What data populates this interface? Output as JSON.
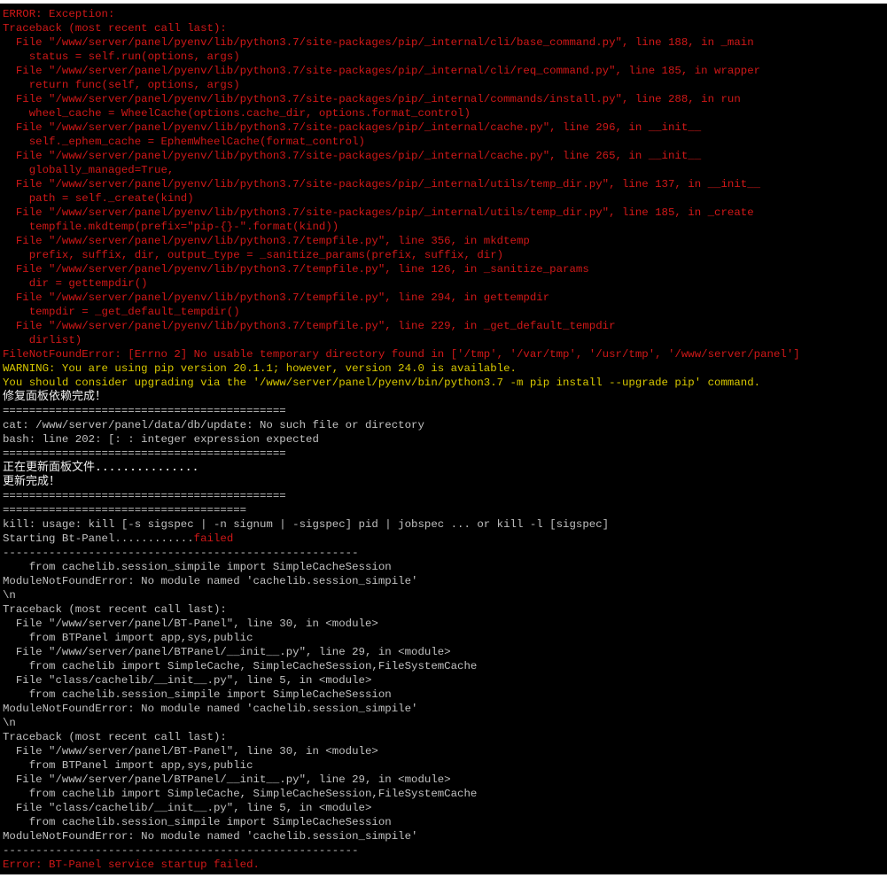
{
  "colors": {
    "red": "#d01818",
    "yellow": "#d8c800",
    "gray": "#c0c0c0",
    "white": "#f0f0f0",
    "background": "#000000"
  },
  "terminal": {
    "lines": [
      {
        "segs": [
          {
            "t": "ERROR: Exception:",
            "c": "red"
          }
        ]
      },
      {
        "segs": [
          {
            "t": "Traceback (most recent call last):",
            "c": "red"
          }
        ]
      },
      {
        "segs": [
          {
            "t": "  File \"/www/server/panel/pyenv/lib/python3.7/site-packages/pip/_internal/cli/base_command.py\", line 188, in _main",
            "c": "red"
          }
        ]
      },
      {
        "segs": [
          {
            "t": "    status = self.run(options, args)",
            "c": "red"
          }
        ]
      },
      {
        "segs": [
          {
            "t": "  File \"/www/server/panel/pyenv/lib/python3.7/site-packages/pip/_internal/cli/req_command.py\", line 185, in wrapper",
            "c": "red"
          }
        ]
      },
      {
        "segs": [
          {
            "t": "    return func(self, options, args)",
            "c": "red"
          }
        ]
      },
      {
        "segs": [
          {
            "t": "  File \"/www/server/panel/pyenv/lib/python3.7/site-packages/pip/_internal/commands/install.py\", line 288, in run",
            "c": "red"
          }
        ]
      },
      {
        "segs": [
          {
            "t": "    wheel_cache = WheelCache(options.cache_dir, options.format_control)",
            "c": "red"
          }
        ]
      },
      {
        "segs": [
          {
            "t": "  File \"/www/server/panel/pyenv/lib/python3.7/site-packages/pip/_internal/cache.py\", line 296, in __init__",
            "c": "red"
          }
        ]
      },
      {
        "segs": [
          {
            "t": "    self._ephem_cache = EphemWheelCache(format_control)",
            "c": "red"
          }
        ]
      },
      {
        "segs": [
          {
            "t": "  File \"/www/server/panel/pyenv/lib/python3.7/site-packages/pip/_internal/cache.py\", line 265, in __init__",
            "c": "red"
          }
        ]
      },
      {
        "segs": [
          {
            "t": "    globally_managed=True,",
            "c": "red"
          }
        ]
      },
      {
        "segs": [
          {
            "t": "  File \"/www/server/panel/pyenv/lib/python3.7/site-packages/pip/_internal/utils/temp_dir.py\", line 137, in __init__",
            "c": "red"
          }
        ]
      },
      {
        "segs": [
          {
            "t": "    path = self._create(kind)",
            "c": "red"
          }
        ]
      },
      {
        "segs": [
          {
            "t": "  File \"/www/server/panel/pyenv/lib/python3.7/site-packages/pip/_internal/utils/temp_dir.py\", line 185, in _create",
            "c": "red"
          }
        ]
      },
      {
        "segs": [
          {
            "t": "    tempfile.mkdtemp(prefix=\"pip-{}-\".format(kind))",
            "c": "red"
          }
        ]
      },
      {
        "segs": [
          {
            "t": "  File \"/www/server/panel/pyenv/lib/python3.7/tempfile.py\", line 356, in mkdtemp",
            "c": "red"
          }
        ]
      },
      {
        "segs": [
          {
            "t": "    prefix, suffix, dir, output_type = _sanitize_params(prefix, suffix, dir)",
            "c": "red"
          }
        ]
      },
      {
        "segs": [
          {
            "t": "  File \"/www/server/panel/pyenv/lib/python3.7/tempfile.py\", line 126, in _sanitize_params",
            "c": "red"
          }
        ]
      },
      {
        "segs": [
          {
            "t": "    dir = gettempdir()",
            "c": "red"
          }
        ]
      },
      {
        "segs": [
          {
            "t": "  File \"/www/server/panel/pyenv/lib/python3.7/tempfile.py\", line 294, in gettempdir",
            "c": "red"
          }
        ]
      },
      {
        "segs": [
          {
            "t": "    tempdir = _get_default_tempdir()",
            "c": "red"
          }
        ]
      },
      {
        "segs": [
          {
            "t": "  File \"/www/server/panel/pyenv/lib/python3.7/tempfile.py\", line 229, in _get_default_tempdir",
            "c": "red"
          }
        ]
      },
      {
        "segs": [
          {
            "t": "    dirlist)",
            "c": "red"
          }
        ]
      },
      {
        "segs": [
          {
            "t": "FileNotFoundError: [Errno 2] No usable temporary directory found in ['/tmp', '/var/tmp', '/usr/tmp', '/www/server/panel']",
            "c": "red"
          }
        ]
      },
      {
        "segs": [
          {
            "t": "WARNING: You are using pip version 20.1.1; however, version 24.0 is available.",
            "c": "yellow"
          }
        ]
      },
      {
        "segs": [
          {
            "t": "You should consider upgrading via the '/www/server/panel/pyenv/bin/python3.7 -m pip install --upgrade pip' command.",
            "c": "yellow"
          }
        ]
      },
      {
        "cjk": true,
        "segs": [
          {
            "t": "修复面板依赖完成！",
            "c": "white"
          }
        ]
      },
      {
        "segs": [
          {
            "t": "===========================================",
            "c": "gray"
          }
        ]
      },
      {
        "segs": [
          {
            "t": "cat: /www/server/panel/data/db/update: No such file or directory",
            "c": "gray"
          }
        ]
      },
      {
        "segs": [
          {
            "t": "bash: line 202: [: : integer expression expected",
            "c": "gray"
          }
        ]
      },
      {
        "segs": [
          {
            "t": "===========================================",
            "c": "gray"
          }
        ]
      },
      {
        "cjk": true,
        "segs": [
          {
            "t": "正在更新面板文件...............",
            "c": "white"
          }
        ]
      },
      {
        "cjk": true,
        "segs": [
          {
            "t": "更新完成！",
            "c": "white"
          }
        ]
      },
      {
        "segs": [
          {
            "t": "===========================================",
            "c": "gray"
          }
        ]
      },
      {
        "segs": [
          {
            "t": "=====================================",
            "c": "gray"
          }
        ]
      },
      {
        "segs": [
          {
            "t": "kill: usage: kill [-s sigspec | -n signum | -sigspec] pid | jobspec ... or kill -l [sigspec]",
            "c": "gray"
          }
        ]
      },
      {
        "segs": [
          {
            "t": "Starting Bt-Panel............",
            "c": "gray"
          },
          {
            "t": "failed",
            "c": "red"
          }
        ]
      },
      {
        "segs": [
          {
            "t": "------------------------------------------------------",
            "c": "gray"
          }
        ]
      },
      {
        "segs": [
          {
            "t": "    from cachelib.session_simpile import SimpleCacheSession",
            "c": "gray"
          }
        ]
      },
      {
        "segs": [
          {
            "t": "ModuleNotFoundError: No module named 'cachelib.session_simpile'",
            "c": "gray"
          }
        ]
      },
      {
        "segs": [
          {
            "t": "\\n",
            "c": "gray"
          }
        ]
      },
      {
        "segs": [
          {
            "t": "Traceback (most recent call last):",
            "c": "gray"
          }
        ]
      },
      {
        "segs": [
          {
            "t": "  File \"/www/server/panel/BT-Panel\", line 30, in <module>",
            "c": "gray"
          }
        ]
      },
      {
        "segs": [
          {
            "t": "    from BTPanel import app,sys,public",
            "c": "gray"
          }
        ]
      },
      {
        "segs": [
          {
            "t": "  File \"/www/server/panel/BTPanel/__init__.py\", line 29, in <module>",
            "c": "gray"
          }
        ]
      },
      {
        "segs": [
          {
            "t": "    from cachelib import SimpleCache, SimpleCacheSession,FileSystemCache",
            "c": "gray"
          }
        ]
      },
      {
        "segs": [
          {
            "t": "  File \"class/cachelib/__init__.py\", line 5, in <module>",
            "c": "gray"
          }
        ]
      },
      {
        "segs": [
          {
            "t": "    from cachelib.session_simpile import SimpleCacheSession",
            "c": "gray"
          }
        ]
      },
      {
        "segs": [
          {
            "t": "ModuleNotFoundError: No module named 'cachelib.session_simpile'",
            "c": "gray"
          }
        ]
      },
      {
        "segs": [
          {
            "t": "\\n",
            "c": "gray"
          }
        ]
      },
      {
        "segs": [
          {
            "t": "Traceback (most recent call last):",
            "c": "gray"
          }
        ]
      },
      {
        "segs": [
          {
            "t": "  File \"/www/server/panel/BT-Panel\", line 30, in <module>",
            "c": "gray"
          }
        ]
      },
      {
        "segs": [
          {
            "t": "    from BTPanel import app,sys,public",
            "c": "gray"
          }
        ]
      },
      {
        "segs": [
          {
            "t": "  File \"/www/server/panel/BTPanel/__init__.py\", line 29, in <module>",
            "c": "gray"
          }
        ]
      },
      {
        "segs": [
          {
            "t": "    from cachelib import SimpleCache, SimpleCacheSession,FileSystemCache",
            "c": "gray"
          }
        ]
      },
      {
        "segs": [
          {
            "t": "  File \"class/cachelib/__init__.py\", line 5, in <module>",
            "c": "gray"
          }
        ]
      },
      {
        "segs": [
          {
            "t": "    from cachelib.session_simpile import SimpleCacheSession",
            "c": "gray"
          }
        ]
      },
      {
        "segs": [
          {
            "t": "ModuleNotFoundError: No module named 'cachelib.session_simpile'",
            "c": "gray"
          }
        ]
      },
      {
        "segs": [
          {
            "t": "------------------------------------------------------",
            "c": "gray"
          }
        ]
      },
      {
        "segs": [
          {
            "t": "Error: BT-Panel service startup failed.",
            "c": "red"
          }
        ]
      }
    ]
  }
}
